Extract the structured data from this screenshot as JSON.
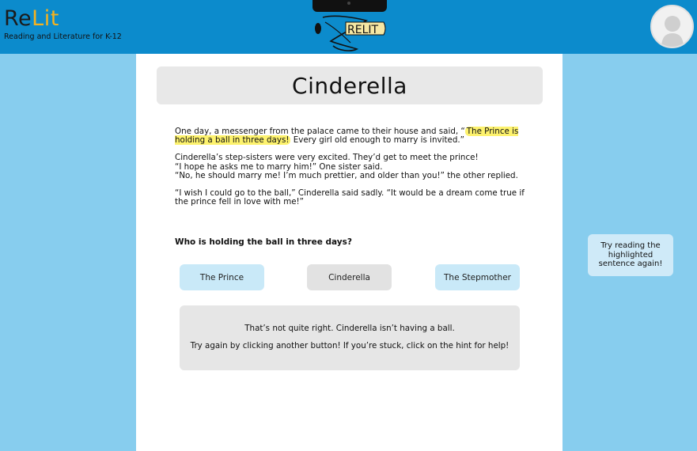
{
  "header": {
    "brand_re": "Re",
    "brand_lit": "Lit",
    "brand_subtitle": "Reading and Literature for K-12",
    "logo_text": "RELIT",
    "avatar_icon": "user-avatar-icon"
  },
  "story": {
    "title": "Cinderella",
    "p1_before": "One day, a messenger from the palace came to their house and said, “",
    "p1_highlight": "The Prince is holding a ball in three days!",
    "p1_after": " Every girl old enough to marry is invited.”",
    "p2_line1": "Cinderella’s step-sisters were very excited. They’d get to meet the prince!",
    "p2_line2": "“I hope he asks me to marry him!” One sister said.",
    "p2_line3": "“No, he should marry me! I’m much prettier, and older than you!” the other replied.",
    "p3": "“I wish I could go to the ball,” Cinderella said sadly. “It would be a dream come true if the prince fell in love with me!”"
  },
  "quiz": {
    "question": "Who is holding the ball in three days?",
    "answers": [
      "The Prince",
      "Cinderella",
      "The Stepmother"
    ],
    "feedback_line1": "That’s not quite right. Cinderella isn’t having a ball.",
    "feedback_line2": "Try again by clicking another button! If you’re stuck, click on the hint for help!"
  },
  "hint": {
    "text": "Try reading the highlighted sentence again!"
  },
  "colors": {
    "header_bg": "#0c8bcc",
    "page_bg": "#87cdee",
    "brand_accent": "#f5b21f",
    "highlight": "#fdf26d",
    "answer_blue": "#c9e9f8",
    "answer_selected": "#e2e2e2"
  }
}
